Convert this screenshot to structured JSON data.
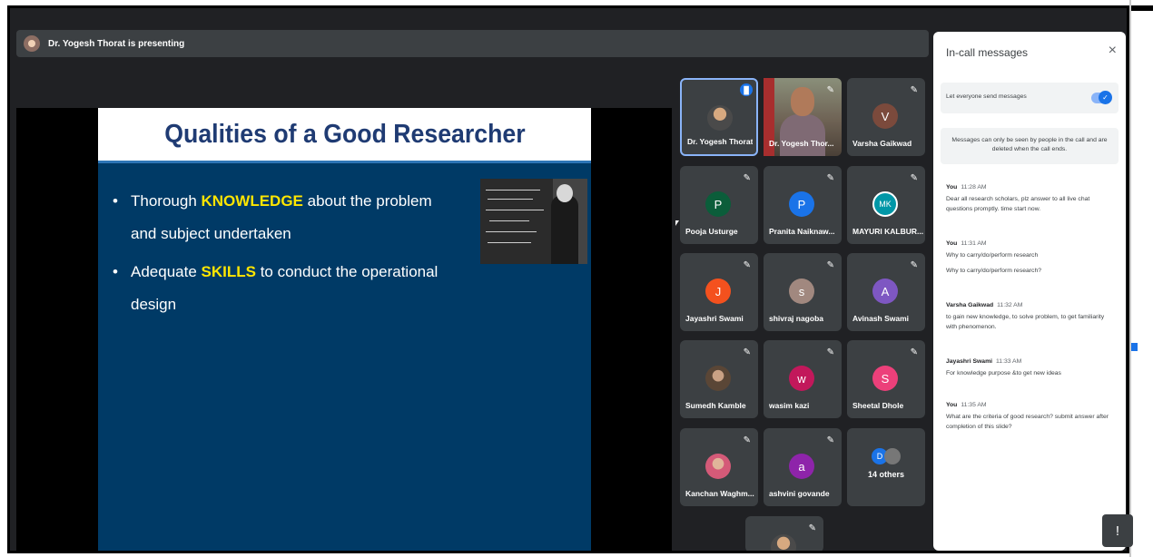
{
  "presenting_bar": {
    "text": "Dr. Yogesh Thorat is presenting"
  },
  "slide": {
    "title": "Qualities of a Good Researcher",
    "bullet1": {
      "pre": "Thorough ",
      "highlight": "KNOWLEDGE",
      "post": " about the problem",
      "cont": "and subject undertaken"
    },
    "bullet2": {
      "pre": "Adequate ",
      "highlight": "SKILLS",
      "post": " to conduct the operational",
      "cont": "design"
    },
    "bullet_symbol": "•"
  },
  "participants": [
    {
      "name": "Dr. Yogesh Thorat",
      "initial": "",
      "color": "",
      "state": "speaking"
    },
    {
      "name": "Dr. Yogesh Thor...",
      "initial": "",
      "color": "",
      "state": "video"
    },
    {
      "name": "Varsha Gaikwad",
      "initial": "V",
      "color": "#7b4a3c"
    },
    {
      "name": "Pooja Usturge",
      "initial": "P",
      "color": "#0b5d3a"
    },
    {
      "name": "Pranita Naiknaw...",
      "initial": "P",
      "color": "#1a73e8"
    },
    {
      "name": "MAYURI KALBUR...",
      "initial": "MK",
      "color": "#0097a7"
    },
    {
      "name": "Jayashri Swami",
      "initial": "J",
      "color": "#f4511e"
    },
    {
      "name": "shivraj nagoba",
      "initial": "s",
      "color": "#a1887f"
    },
    {
      "name": "Avinash Swami",
      "initial": "A",
      "color": "#7e57c2"
    },
    {
      "name": "Sumedh Kamble",
      "initial": "",
      "color": ""
    },
    {
      "name": "wasim kazi",
      "initial": "w",
      "color": "#c2185b"
    },
    {
      "name": "Sheetal Dhole",
      "initial": "S",
      "color": "#ec407a"
    },
    {
      "name": "Kanchan Waghm...",
      "initial": "",
      "color": ""
    },
    {
      "name": "ashvini govande",
      "initial": "a",
      "color": "#8e24aa"
    },
    {
      "name": "14 others",
      "initial": "D",
      "color": "#1a73e8"
    }
  ],
  "chat": {
    "title": "In-call messages",
    "close": "×",
    "setting_label": "Let everyone send messages",
    "notice": "Messages can only be seen by people in the call and are deleted when the call ends.",
    "messages": [
      {
        "sender": "You",
        "time": "11:28 AM",
        "text": "Dear all research scholars, plz answer to all live chat questions promptly. time start now."
      },
      {
        "sender": "You",
        "time": "11:31 AM",
        "text": "Why to carry/do/perform research",
        "text2": "Why to carry/do/perform research?"
      },
      {
        "sender": "Varsha Gaikwad",
        "time": "11:32 AM",
        "text": "to gain new knowledge, to solve problem, to get familiarity with phenomenon."
      },
      {
        "sender": "Jayashri Swami",
        "time": "11:33 AM",
        "text": "For knowledge purpose &to get new ideas"
      },
      {
        "sender": "You",
        "time": "11:35 AM",
        "text": "What are the criteria of good research? submit answer after completion of this slide?"
      }
    ]
  },
  "icons": {
    "mic_off": "✎",
    "help": "!"
  }
}
